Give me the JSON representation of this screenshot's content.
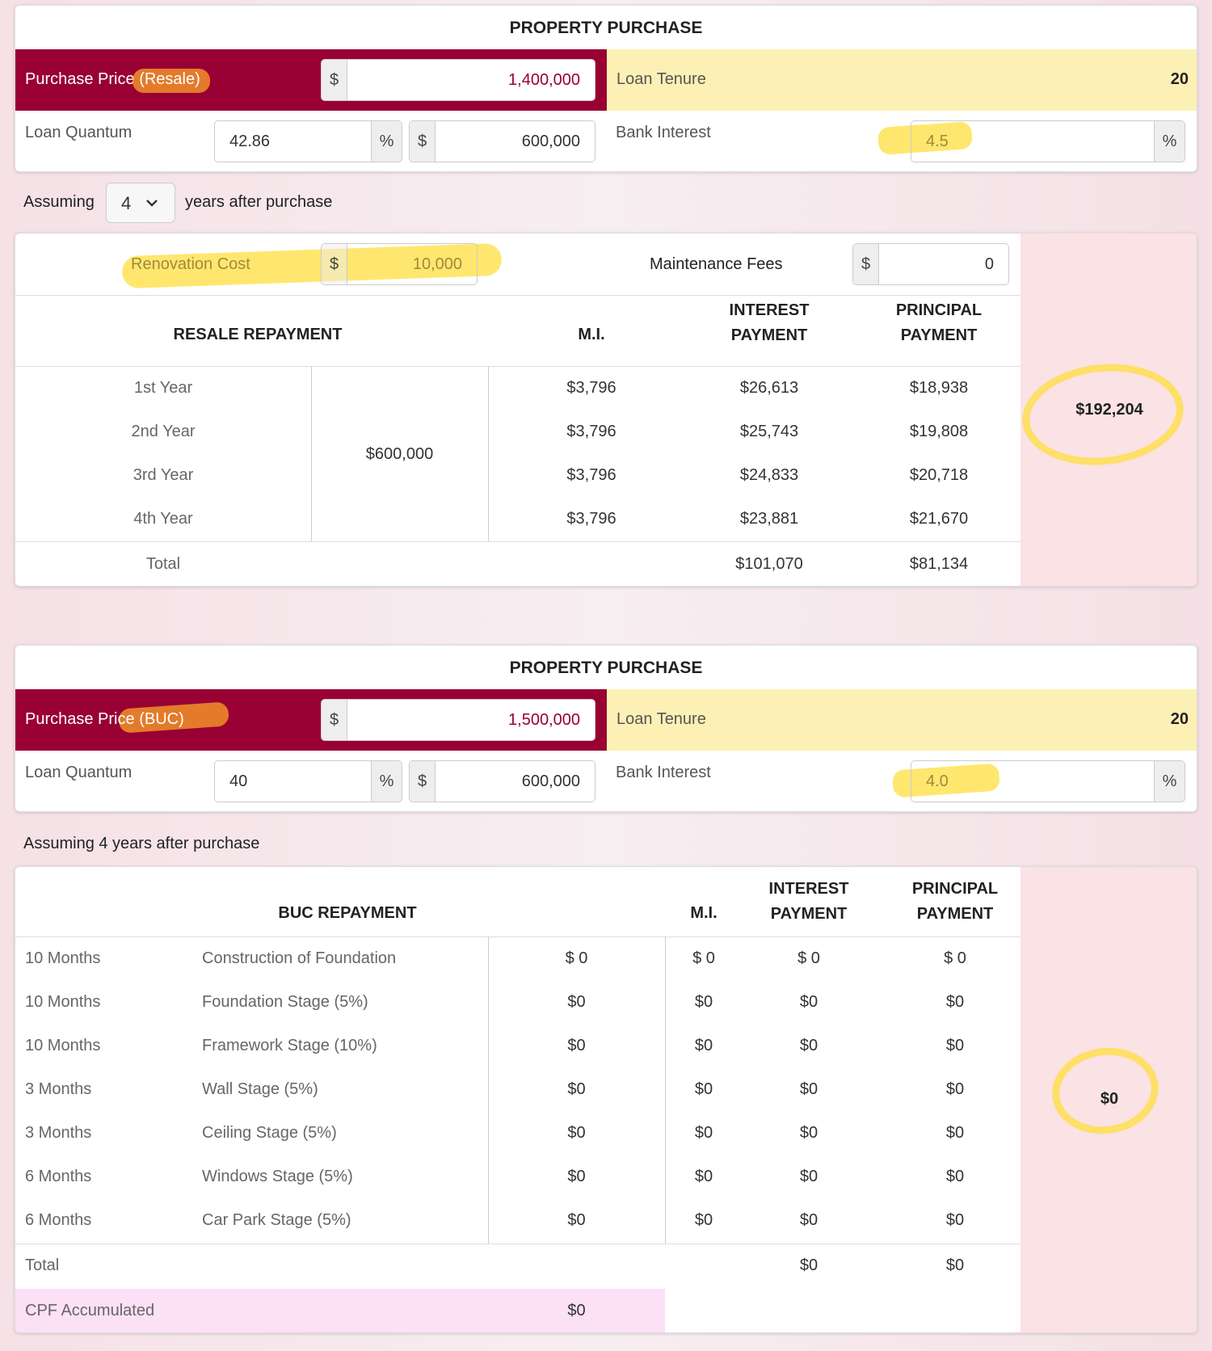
{
  "resale": {
    "title": "PROPERTY PURCHASE",
    "purchase_price_label": "Purchase Price",
    "purchase_price_tag": "(Resale)",
    "currency": "$",
    "purchase_price": "1,400,000",
    "loan_tenure_label": "Loan Tenure",
    "loan_tenure": "20",
    "loan_quantum_label": "Loan Quantum",
    "loan_quantum_pct": "42.86",
    "pct": "%",
    "loan_amount": "600,000",
    "bank_interest_label": "Bank Interest",
    "bank_interest": "4.5"
  },
  "assumption": {
    "prefix": "Assuming",
    "years": "4",
    "suffix": "years after purchase"
  },
  "resale_repayment": {
    "renovation_label": "Renovation Cost",
    "renovation_value": "10,000",
    "maintenance_label": "Maintenance Fees",
    "maintenance_value": "0",
    "headers": {
      "section": "RESALE REPAYMENT",
      "mi": "M.I.",
      "interest_1": "INTEREST",
      "interest_2": "PAYMENT",
      "principal_1": "PRINCIPAL",
      "principal_2": "PAYMENT"
    },
    "loan_amount": "$600,000",
    "rows": [
      {
        "year": "1st Year",
        "mi": "$3,796",
        "interest": "$26,613",
        "principal": "$18,938"
      },
      {
        "year": "2nd Year",
        "mi": "$3,796",
        "interest": "$25,743",
        "principal": "$19,808"
      },
      {
        "year": "3rd Year",
        "mi": "$3,796",
        "interest": "$24,833",
        "principal": "$20,718"
      },
      {
        "year": "4th Year",
        "mi": "$3,796",
        "interest": "$23,881",
        "principal": "$21,670"
      }
    ],
    "total_label": "Total",
    "total_interest": "$101,070",
    "total_principal": "$81,134",
    "side_total": "$192,204"
  },
  "buc": {
    "title": "PROPERTY PURCHASE",
    "purchase_price_label": "Purchase Price",
    "purchase_price_tag": "(BUC)",
    "currency": "$",
    "purchase_price": "1,500,000",
    "loan_tenure_label": "Loan Tenure",
    "loan_tenure": "20",
    "loan_quantum_label": "Loan Quantum",
    "loan_quantum_pct": "40",
    "pct": "%",
    "loan_amount": "600,000",
    "bank_interest_label": "Bank Interest",
    "bank_interest": "4.0"
  },
  "buc_assumption": "Assuming 4 years after purchase",
  "buc_repayment": {
    "headers": {
      "section": "BUC REPAYMENT",
      "mi": "M.I.",
      "interest_1": "INTEREST",
      "interest_2": "PAYMENT",
      "principal_1": "PRINCIPAL",
      "principal_2": "PAYMENT"
    },
    "rows": [
      {
        "duration": "10 Months",
        "stage": "Construction of Foundation",
        "amount": "$ 0",
        "mi": "$ 0",
        "interest": "$ 0",
        "principal": "$ 0"
      },
      {
        "duration": "10 Months",
        "stage": "Foundation Stage (5%)",
        "amount": "$0",
        "mi": "$0",
        "interest": "$0",
        "principal": "$0"
      },
      {
        "duration": "10 Months",
        "stage": "Framework Stage (10%)",
        "amount": "$0",
        "mi": "$0",
        "interest": "$0",
        "principal": "$0"
      },
      {
        "duration": "3 Months",
        "stage": "Wall Stage (5%)",
        "amount": "$0",
        "mi": "$0",
        "interest": "$0",
        "principal": "$0"
      },
      {
        "duration": "3 Months",
        "stage": "Ceiling Stage (5%)",
        "amount": "$0",
        "mi": "$0",
        "interest": "$0",
        "principal": "$0"
      },
      {
        "duration": "6 Months",
        "stage": "Windows Stage (5%)",
        "amount": "$0",
        "mi": "$0",
        "interest": "$0",
        "principal": "$0"
      },
      {
        "duration": "6 Months",
        "stage": "Car Park Stage (5%)",
        "amount": "$0",
        "mi": "$0",
        "interest": "$0",
        "principal": "$0"
      }
    ],
    "total_label": "Total",
    "total_interest": "$0",
    "total_principal": "$0",
    "cpf_label": "CPF Accumulated",
    "cpf_value": "$0",
    "side_total": "$0"
  }
}
